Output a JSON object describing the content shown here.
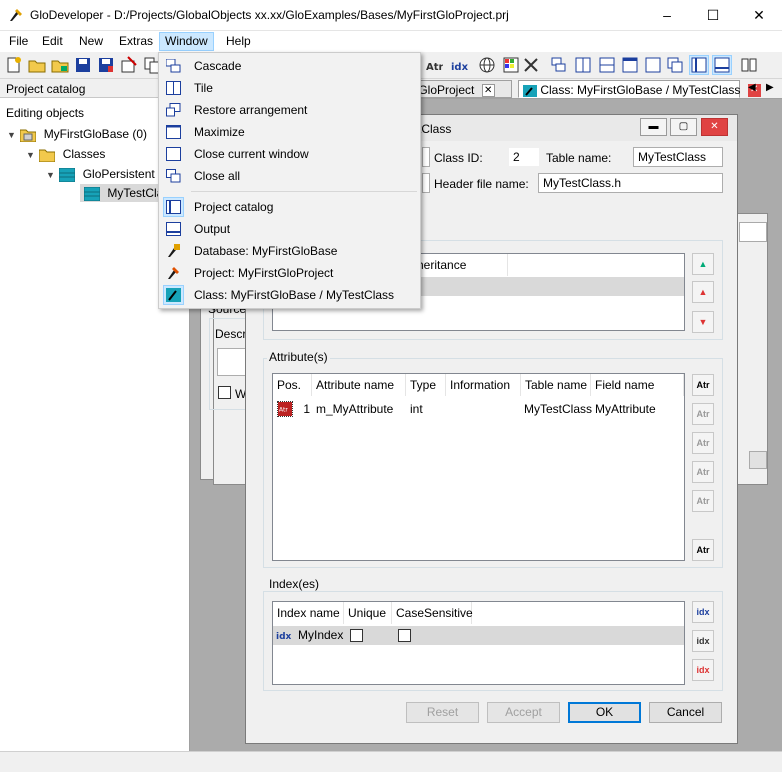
{
  "window": {
    "title": "GloDeveloper - D:/Projects/GlobalObjects xx.xx/GloExamples/Bases/MyFirstGloProject.prj",
    "minimize": "–",
    "maximize": "☐",
    "close": "✕"
  },
  "menubar": {
    "file": "File",
    "edit": "Edit",
    "new": "New",
    "extras": "Extras",
    "window": "Window",
    "help": "Help"
  },
  "window_menu": {
    "items": [
      {
        "label": "Cascade",
        "icon": "cascade-icon"
      },
      {
        "label": "Tile",
        "icon": "tile-icon"
      },
      {
        "label": "Restore arrangement",
        "icon": "restore-arrangement-icon"
      },
      {
        "label": "Maximize",
        "icon": "maximize-icon"
      },
      {
        "label": "Close current window",
        "icon": "close-window-icon"
      },
      {
        "label": "Close all",
        "icon": "close-all-icon"
      },
      {
        "label": "Project catalog",
        "icon": "project-catalog-icon"
      },
      {
        "label": "Output",
        "icon": "output-icon"
      },
      {
        "label": "Database: MyFirstGloBase",
        "icon": "database-icon"
      },
      {
        "label": "Project: MyFirstGloProject",
        "icon": "project-icon"
      },
      {
        "label": "Class: MyFirstGloBase / MyTestClass",
        "icon": "class-icon"
      }
    ]
  },
  "catalog": {
    "header": "Project catalog",
    "editing": "Editing objects",
    "tree": [
      {
        "label": "MyFirstGloBase (0)",
        "level": 1
      },
      {
        "label": "Classes",
        "level": 2
      },
      {
        "label": "GloPersistent",
        "level": 3
      },
      {
        "label": "MyTestClass",
        "level": 4
      }
    ]
  },
  "tabs": [
    {
      "label": "tGloProject"
    },
    {
      "label": "Class: MyFirstGloBase / MyTestClass"
    }
  ],
  "bg_dialog": {
    "source": "Source",
    "descr": "Descr",
    "w": "W"
  },
  "dialog": {
    "title": "tClass",
    "class_id_label": "Class ID:",
    "class_id": "2",
    "table_name_label": "Table name:",
    "table_name": "MyTestClass",
    "header_file_label": "Header file name:",
    "header_file": "MyTestClass.h",
    "inheritance_col": "heritance",
    "attributes_group": "Attribute(s)",
    "attr_columns": [
      "Pos.",
      "Attribute name",
      "Type",
      "Information",
      "Table name",
      "Field name"
    ],
    "attr_rows": [
      {
        "pos": "1",
        "name": "m_MyAttribute",
        "type": "int",
        "info": "",
        "table": "MyTestClass",
        "field": "MyAttribute"
      }
    ],
    "index_group": "Index(es)",
    "index_columns": [
      "Index name",
      "Unique",
      "CaseSensitive"
    ],
    "index_rows": [
      {
        "name": "MyIndex",
        "unique": false,
        "case": false
      }
    ],
    "reset": "Reset",
    "accept": "Accept",
    "ok": "OK",
    "cancel": "Cancel"
  },
  "colors": {
    "menu_highlight": "#cce8ff",
    "accent": "#0078d7",
    "selection_gray": "#d9d9d9"
  }
}
